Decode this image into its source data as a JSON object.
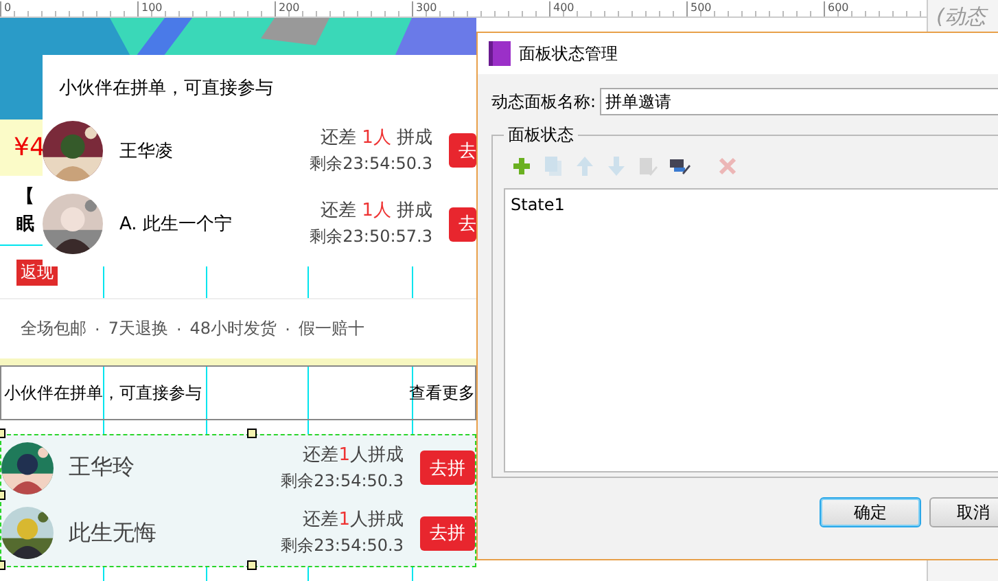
{
  "ruler": {
    "ticks": [
      "0",
      "100",
      "200",
      "300",
      "400",
      "500",
      "600"
    ]
  },
  "page": {
    "banner": {
      "kind": "picture"
    },
    "price": "¥4",
    "title_lines": [
      "【",
      "眠"
    ],
    "badge": "返现",
    "services": [
      "全场包邮",
      "7天退换",
      "48小时发货",
      "假一赔十"
    ],
    "separator": "·",
    "group_header": {
      "title": "小伙伴在拼单，可直接参与",
      "link": "查看更多"
    },
    "group_rows": [
      {
        "name": "王华玲",
        "need": [
          "还差",
          "1",
          "人拼成"
        ],
        "remaining": "剩余23:54:50.3",
        "button": "去拼"
      },
      {
        "name": "此生无悔",
        "need": [
          "还差",
          "1",
          "人拼成"
        ],
        "remaining": "剩余23:54:50.3",
        "button": "去拼"
      }
    ]
  },
  "popup": {
    "title": "小伙伴在拼单，可直接参与",
    "rows": [
      {
        "name": "王华凌",
        "need": [
          "还差 ",
          "1人",
          " 拼成"
        ],
        "remaining": "剩余23:54:50.3",
        "button": "去"
      },
      {
        "name": "A. 此生一个宁",
        "need": [
          "还差 ",
          "1人",
          " 拼成"
        ],
        "remaining": "剩余23:50:57.3",
        "button": "去"
      }
    ]
  },
  "right_pane": {
    "label": "(动态"
  },
  "dialog": {
    "title": "面板状态管理",
    "name_label": "动态面板名称:",
    "name_value": "拼单邀请",
    "group_label": "面板状态",
    "tools": [
      {
        "kind": "add",
        "disabled": false
      },
      {
        "kind": "duplicate",
        "disabled": true
      },
      {
        "kind": "up",
        "disabled": true
      },
      {
        "kind": "down",
        "disabled": true
      },
      {
        "kind": "edit",
        "disabled": true
      },
      {
        "kind": "edit_all",
        "disabled": false
      },
      {
        "kind": "delete",
        "disabled": true
      }
    ],
    "states": [
      {
        "label": "State1",
        "selected": false
      }
    ],
    "buttons": [
      {
        "label": "确定",
        "default": true
      },
      {
        "label": "取消",
        "default": false
      }
    ]
  }
}
